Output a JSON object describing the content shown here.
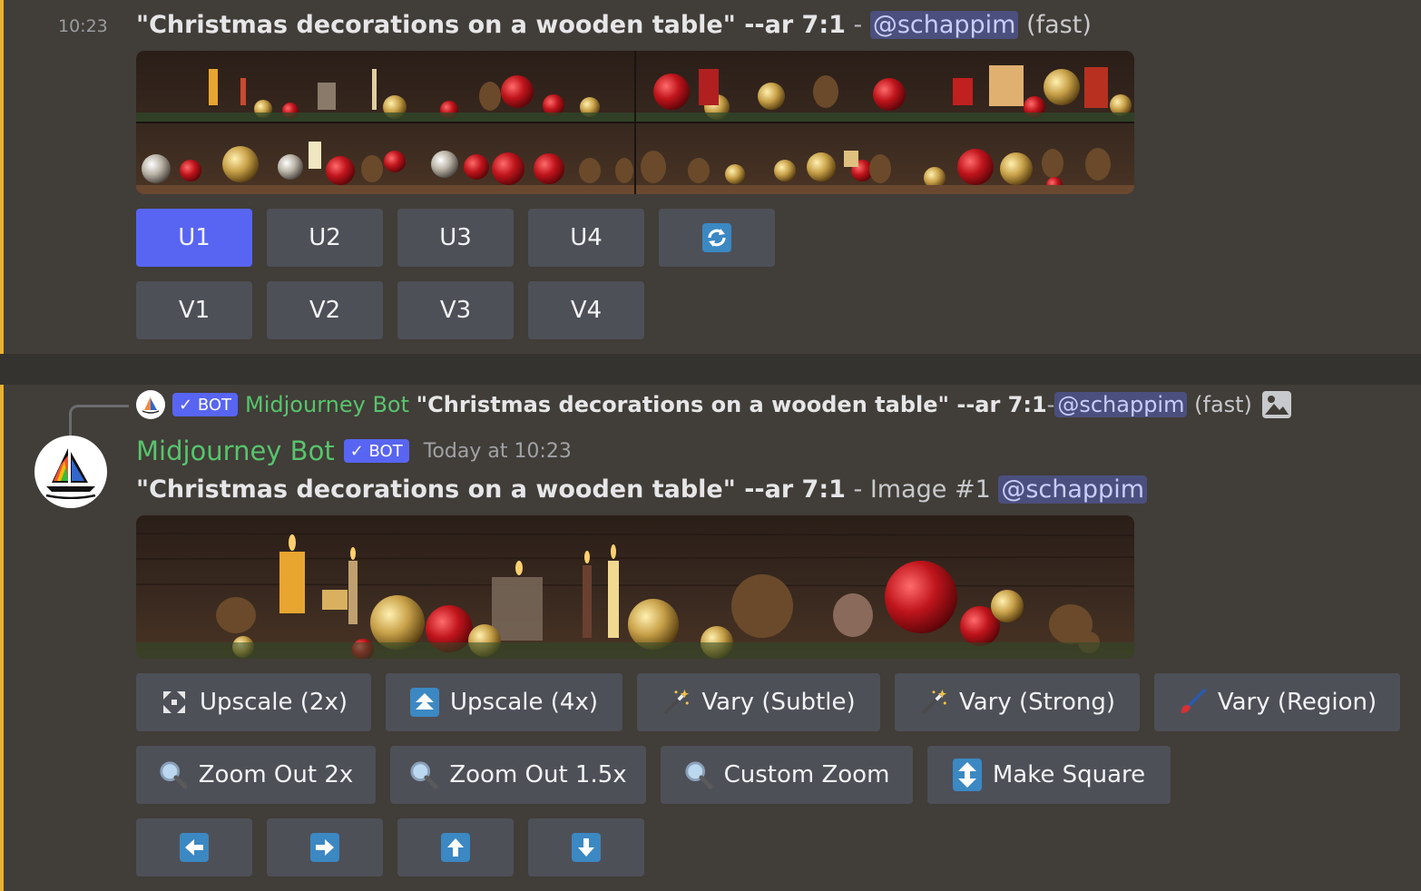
{
  "message1": {
    "timestamp": "10:23",
    "prompt": "\"Christmas decorations on a wooden table\" --ar 7:1",
    "dash": " - ",
    "mention": "@schappim",
    "speed": "(fast)",
    "image_alt": "Christmas decorations grid",
    "upscale_buttons": [
      "U1",
      "U2",
      "U3",
      "U4"
    ],
    "variation_buttons": [
      "V1",
      "V2",
      "V3",
      "V4"
    ],
    "reroll_icon": "refresh-icon"
  },
  "message2": {
    "reply": {
      "bot_badge": "BOT",
      "bot_name": "Midjourney Bot",
      "prompt": "\"Christmas decorations on a wooden table\" --ar 7:1",
      "dash": " - ",
      "mention": "@schappim",
      "speed": "(fast)"
    },
    "author": "Midjourney Bot",
    "bot_badge": "BOT",
    "time": "Today at 10:23",
    "prompt": "\"Christmas decorations on a wooden table\" --ar 7:1",
    "suffix": " - Image #1 ",
    "mention": "@schappim",
    "image_alt": "Upscaled Christmas decorations image",
    "buttons_row1": [
      {
        "label": "Upscale (2x)",
        "icon": "expand-icon"
      },
      {
        "label": "Upscale (4x)",
        "icon": "up-arrow-icon"
      },
      {
        "label": "Vary (Subtle)",
        "icon": "magic-wand-icon"
      },
      {
        "label": "Vary (Strong)",
        "icon": "magic-wand-icon"
      },
      {
        "label": "Vary (Region)",
        "icon": "paintbrush-icon"
      }
    ],
    "buttons_row2": [
      {
        "label": "Zoom Out 2x",
        "icon": "magnifier-icon"
      },
      {
        "label": "Zoom Out 1.5x",
        "icon": "magnifier-icon"
      },
      {
        "label": "Custom Zoom",
        "icon": "magnifier-icon"
      },
      {
        "label": "Make Square",
        "icon": "up-down-arrow-icon"
      }
    ],
    "pan_buttons": [
      "arrow-left-icon",
      "arrow-right-icon",
      "arrow-up-icon",
      "arrow-down-icon"
    ]
  },
  "colors": {
    "accent_border": "#eab12d",
    "primary_button": "#5865f2",
    "secondary_button": "#4e5058",
    "bot_name": "#57c46d",
    "mention_bg": "#4b4f7d"
  }
}
